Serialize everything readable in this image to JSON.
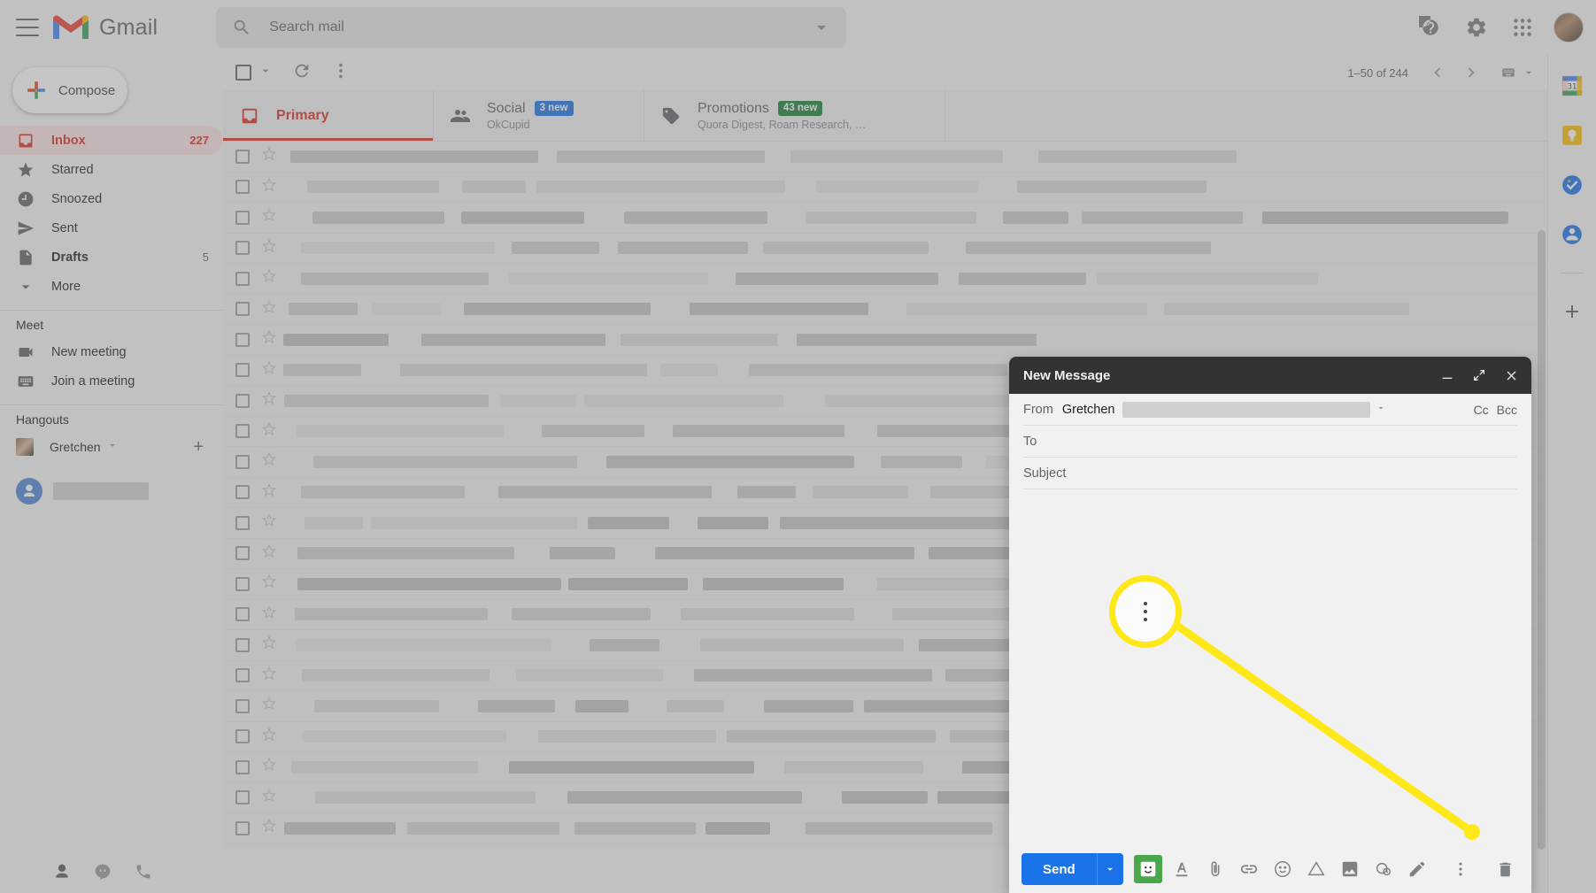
{
  "app": {
    "brand": "Gmail",
    "hamburger_icon": "hamburger-menu-icon",
    "logo_icon": "gmail-m-logo-icon"
  },
  "search": {
    "placeholder": "Search mail",
    "value": "",
    "icon": "search-icon",
    "options_icon": "search-options-caret-icon"
  },
  "topbar_actions": [
    {
      "name": "support-icon",
      "glyph": "?"
    },
    {
      "name": "settings-gear-icon",
      "glyph": "gear"
    },
    {
      "name": "google-apps-grid-icon",
      "glyph": "grid"
    },
    {
      "name": "account-avatar",
      "glyph": "avatar"
    }
  ],
  "sidebar": {
    "compose": {
      "label": "Compose",
      "icon": "plus-icon"
    },
    "items": [
      {
        "label": "Inbox",
        "count": "227",
        "icon": "inbox-icon",
        "active": true,
        "bold": true
      },
      {
        "label": "Starred",
        "count": "",
        "icon": "star-icon",
        "active": false,
        "bold": false
      },
      {
        "label": "Snoozed",
        "count": "",
        "icon": "clock-icon",
        "active": false,
        "bold": false
      },
      {
        "label": "Sent",
        "count": "",
        "icon": "send-icon",
        "active": false,
        "bold": false
      },
      {
        "label": "Drafts",
        "count": "5",
        "icon": "draft-icon",
        "active": false,
        "bold": true
      },
      {
        "label": "More",
        "count": "",
        "icon": "chevron-down-icon",
        "active": false,
        "bold": false
      }
    ],
    "meet": {
      "title": "Meet",
      "items": [
        {
          "label": "New meeting",
          "icon": "video-camera-icon"
        },
        {
          "label": "Join a meeting",
          "icon": "keyboard-icon"
        }
      ]
    },
    "hangouts": {
      "title": "Hangouts",
      "user": "Gretchen",
      "caret_icon": "chevron-down-icon",
      "add_icon": "plus-icon"
    },
    "footer_icons": [
      {
        "name": "contacts-icon"
      },
      {
        "name": "hangouts-icon"
      },
      {
        "name": "phone-icon"
      }
    ]
  },
  "toolbar": {
    "select_all_icon": "checkbox-icon",
    "select_caret_icon": "chevron-down-icon",
    "refresh_icon": "refresh-icon",
    "more_icon": "more-vertical-icon",
    "pagination": "1–50 of 244",
    "prev_icon": "chevron-left-icon",
    "next_icon": "chevron-right-icon",
    "input_tools_icon": "keyboard-icon",
    "input_tools_caret_icon": "chevron-down-icon"
  },
  "tabs": [
    {
      "label": "Primary",
      "badge": "",
      "badge_color": "",
      "sub": "",
      "icon": "inbox-tab-icon",
      "active": true
    },
    {
      "label": "Social",
      "badge": "3 new",
      "badge_color": "#1a73e8",
      "sub": "OkCupid",
      "icon": "people-tab-icon",
      "active": false
    },
    {
      "label": "Promotions",
      "badge": "43 new",
      "badge_color": "#188038",
      "sub": "Quora Digest, Roam Research, …",
      "icon": "tag-tab-icon",
      "active": false
    }
  ],
  "compose_window": {
    "title": "New Message",
    "minimize_icon": "minimize-icon",
    "maximize_icon": "expand-icon",
    "close_icon": "close-icon",
    "from_label": "From",
    "from_name": "Gretchen",
    "from_caret_icon": "chevron-down-icon",
    "cc_label": "Cc",
    "bcc_label": "Bcc",
    "to_label": "To",
    "subject_label": "Subject",
    "body_value": "",
    "send_label": "Send",
    "send_caret_icon": "chevron-down-icon",
    "tools": [
      {
        "name": "emoji-sticker-icon",
        "highlight": true
      },
      {
        "name": "formatting-options-icon",
        "highlight": false
      },
      {
        "name": "attach-file-icon",
        "highlight": false
      },
      {
        "name": "insert-link-icon",
        "highlight": false
      },
      {
        "name": "insert-emoji-icon",
        "highlight": false
      },
      {
        "name": "insert-drive-file-icon",
        "highlight": false
      },
      {
        "name": "insert-photo-icon",
        "highlight": false
      },
      {
        "name": "confidential-mode-icon",
        "highlight": false
      },
      {
        "name": "insert-signature-icon",
        "highlight": false
      }
    ],
    "more_options_icon": "more-vertical-icon",
    "discard_icon": "trash-icon"
  },
  "callout": {
    "target_icon": "more-vertical-icon",
    "highlight_color": "#ffe81a"
  },
  "right_rail": [
    {
      "name": "google-calendar-icon",
      "label": "31"
    },
    {
      "name": "google-keep-icon",
      "label": ""
    },
    {
      "name": "google-tasks-icon",
      "label": ""
    },
    {
      "name": "google-contacts-icon",
      "label": ""
    },
    {
      "name": "add-app-icon",
      "label": ""
    }
  ]
}
